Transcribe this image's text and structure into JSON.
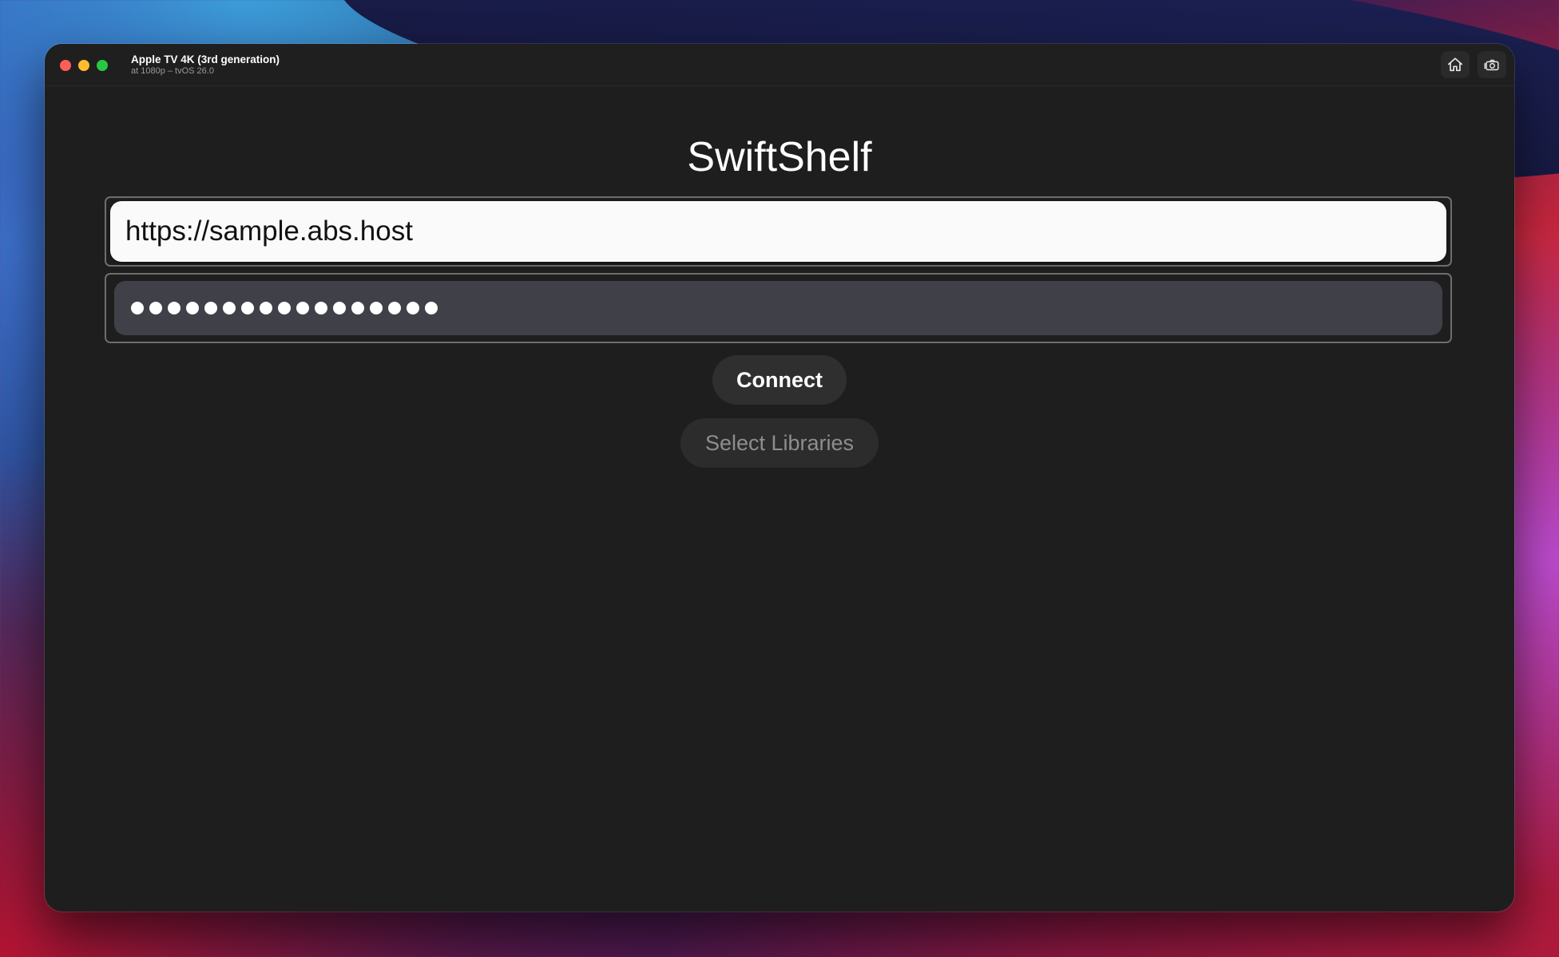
{
  "window": {
    "title": "Apple TV 4K (3rd generation)",
    "subtitle": "at 1080p – tvOS 26.0"
  },
  "toolbar": {
    "home_icon": "home-icon",
    "screenshot_icon": "camera-icon"
  },
  "app": {
    "title": "SwiftShelf",
    "server_url": "https://sample.abs.host",
    "api_key_masked_length": 17,
    "connect_label": "Connect",
    "select_libraries_label": "Select Libraries"
  },
  "colors": {
    "window_bg": "#1e1e1e",
    "url_field_bg": "#fafafa",
    "password_field_bg": "#404048",
    "button_bg": "#2f2f2f",
    "disabled_text": "#8e8e8e",
    "traffic_close": "#ff5f57",
    "traffic_min": "#febc2e",
    "traffic_max": "#28c840"
  }
}
